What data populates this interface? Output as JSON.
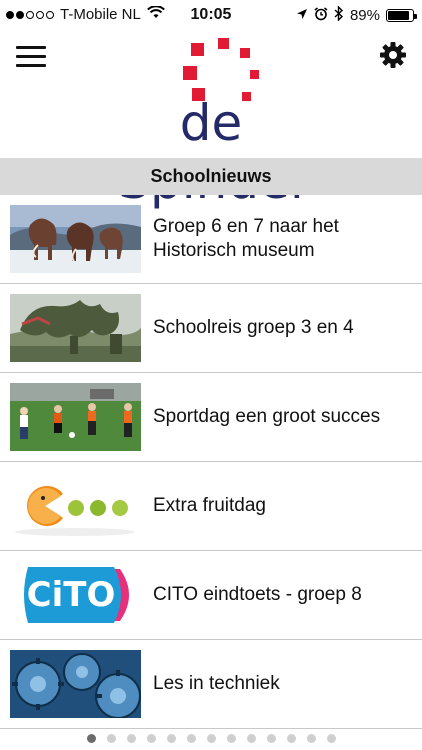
{
  "status_bar": {
    "carrier": "T-Mobile NL",
    "time": "10:05",
    "battery": "89%",
    "battery_level": 0.89,
    "signal_bars_filled": 2,
    "signal_bars_total": 5
  },
  "header": {
    "logo_text": "de Spindel",
    "menu_icon": "hamburger-menu-icon",
    "settings_icon": "gear-icon",
    "brand_color": "#232a67",
    "accent_color": "#e11b33"
  },
  "section": {
    "title": "Schoolnieuws"
  },
  "news": [
    {
      "title": "Groep 6 en 7 naar het Historisch museum",
      "thumbnail": "mammoths-diorama"
    },
    {
      "title": "Schoolreis groep 3 en 4",
      "thumbnail": "dragon-sculpture"
    },
    {
      "title": "Sportdag een groot succes",
      "thumbnail": "football-match"
    },
    {
      "title": "Extra fruitdag",
      "thumbnail": "orange-and-limes"
    },
    {
      "title": "CITO eindtoets - groep 8",
      "thumbnail": "cito-logo",
      "thumbnail_text": "CiTO"
    },
    {
      "title": "Les in techniek",
      "thumbnail": "gears-machinery"
    }
  ],
  "pager": {
    "pages": 13,
    "active": 1
  }
}
